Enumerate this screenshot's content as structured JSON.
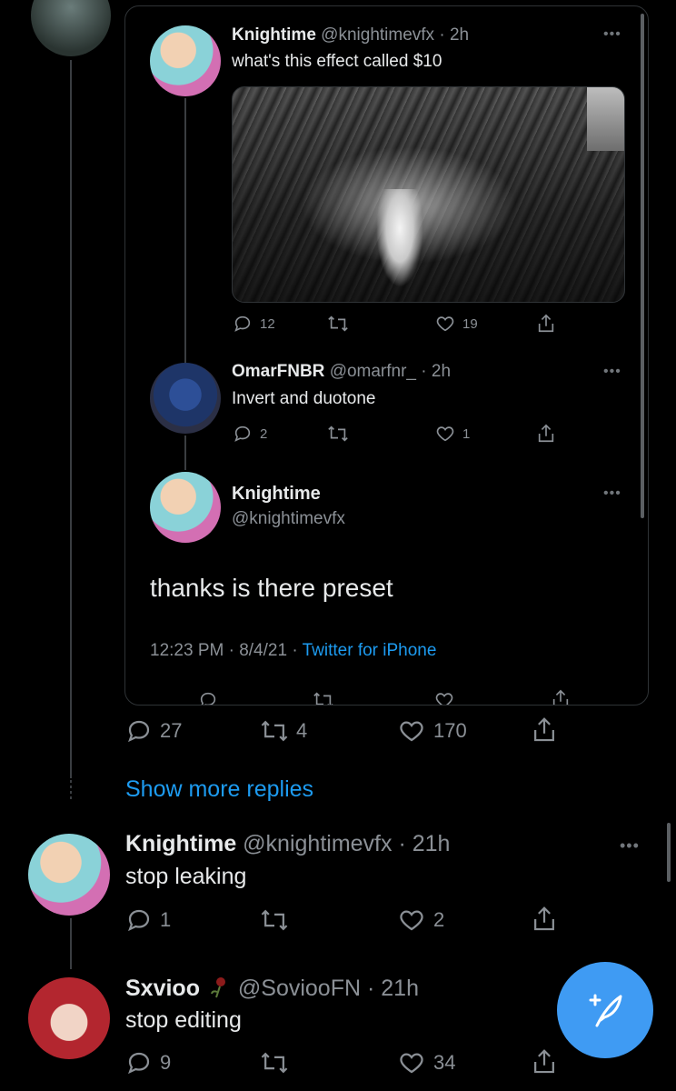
{
  "quoted_thread": {
    "tweet1": {
      "display_name": "Knightime",
      "handle": "@knightimevfx",
      "time": "· 2h",
      "text": "what's this effect called $10",
      "replies": "12",
      "retweets": "",
      "likes": "19"
    },
    "tweet2": {
      "display_name": "OmarFNBR",
      "handle": "@omarfnr_",
      "time": "· 2h",
      "text": "Invert and duotone",
      "replies": "2",
      "retweets": "",
      "likes": "1"
    },
    "focus_tweet": {
      "display_name": "Knightime",
      "handle": "@knightimevfx",
      "text": "thanks is there preset",
      "timestamp": "12:23 PM · 8/4/21 ·",
      "source": "Twitter for iPhone"
    }
  },
  "parent_actions": {
    "replies": "27",
    "retweets": "4",
    "likes": "170"
  },
  "show_more_replies": "Show more replies",
  "replies": [
    {
      "display_name": "Knightime",
      "handle": "@knightimevfx",
      "time": "· 21h",
      "text": "stop leaking",
      "replies": "1",
      "retweets": "",
      "likes": "2"
    },
    {
      "display_name": "Sxvioo",
      "handle": "@SoviooFN",
      "time": "· 21h",
      "text": "stop editing",
      "replies": "9",
      "retweets": "",
      "likes": "34"
    }
  ],
  "colors": {
    "background": "#000000",
    "accent": "#1d9bf0",
    "muted_text": "#8b9096",
    "fab": "#3f9bf3"
  },
  "icons": {
    "reply": "reply-icon",
    "retweet": "retweet-icon",
    "like": "heart-icon",
    "share": "share-icon",
    "more": "more-icon",
    "compose": "compose-tweet-icon"
  }
}
